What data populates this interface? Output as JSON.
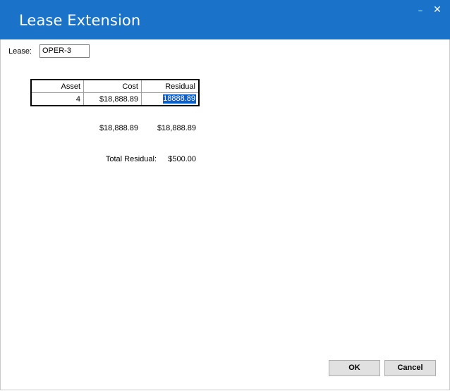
{
  "window": {
    "title": "Lease Extension",
    "minimize_glyph": "–",
    "close_glyph": "✕"
  },
  "form": {
    "lease_label": "Lease:",
    "lease_value": "OPER-3"
  },
  "grid": {
    "headers": [
      "Asset",
      "Cost",
      "Residual"
    ],
    "rows": [
      {
        "asset": "4",
        "cost": "$18,888.89",
        "residual": "18888.89"
      }
    ]
  },
  "totals": {
    "cost_total": "$18,888.89",
    "residual_total": "$18,888.89",
    "total_residual_label": "Total Residual:",
    "total_residual_value": "$500.00"
  },
  "buttons": {
    "ok": "OK",
    "cancel": "Cancel"
  },
  "colors": {
    "titlebar": "#1a73c9",
    "selection": "#0a5fcf"
  }
}
